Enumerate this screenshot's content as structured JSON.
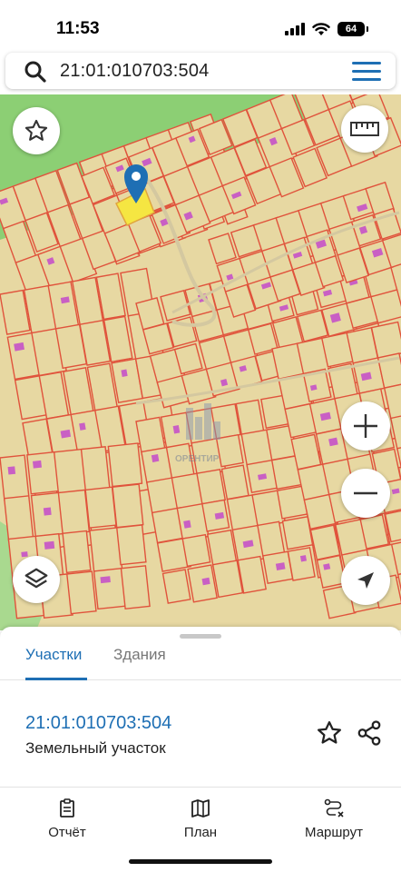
{
  "status_bar": {
    "time": "11:53",
    "battery": "64"
  },
  "search": {
    "query": "21:01:010703:504"
  },
  "map": {
    "watermark": "ОРЕНТИР",
    "buttons": [
      "favorite-star",
      "ruler",
      "layers",
      "zoom-in",
      "zoom-out",
      "location-arrow"
    ],
    "colors": {
      "forest": "#8ccf74",
      "parcel_fill": "#e7d8a2",
      "parcel_border": "#e0533c",
      "selected": "#f5e642",
      "building": "#c95fc4",
      "pin": "#1e6fb4"
    }
  },
  "sheet": {
    "tabs": [
      {
        "label": "Участки",
        "active": true
      },
      {
        "label": "Здания",
        "active": false
      }
    ],
    "result": {
      "number": "21:01:010703:504",
      "type": "Земельный участок"
    }
  },
  "bottom_nav": [
    {
      "label": "Отчёт",
      "icon": "report-icon"
    },
    {
      "label": "План",
      "icon": "map-icon"
    },
    {
      "label": "Маршрут",
      "icon": "route-icon"
    }
  ]
}
